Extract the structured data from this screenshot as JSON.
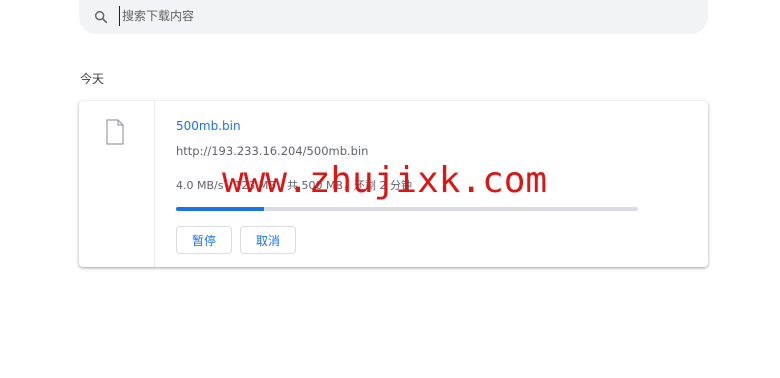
{
  "search": {
    "placeholder": "搜索下载内容"
  },
  "date_group": {
    "label": "今天"
  },
  "download": {
    "file_name": "500mb.bin",
    "url": "http://193.233.16.204/500mb.bin",
    "status": "4.0 MB/s - 123 MB，共 500 MB，还剩 2 分钟",
    "progress": 0.19,
    "buttons": {
      "pause": "暂停",
      "cancel": "取消"
    }
  },
  "watermark": {
    "text": "www.zhujixk.com"
  },
  "colors": {
    "accent": "#1a73e8",
    "watermark": "#e01414",
    "search_bg": "#f1f3f4"
  }
}
